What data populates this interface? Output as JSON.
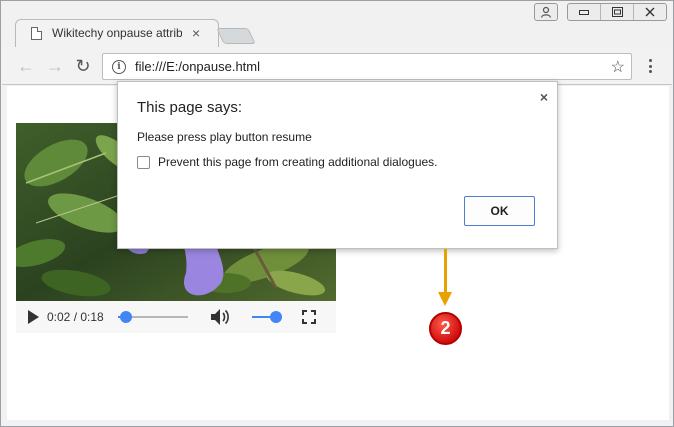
{
  "browser": {
    "tab": {
      "title": "Wikitechy onpause attrib",
      "close_glyph": "×"
    },
    "window_controls": {
      "minimize_glyph": "▭",
      "restore_glyph": "⧉",
      "close_glyph": "✕"
    },
    "toolbar": {
      "back_glyph": "←",
      "forward_glyph": "→",
      "reload_glyph": "↻",
      "url": "file:///E:/onpause.html",
      "info_glyph": "i",
      "star_glyph": "☆"
    }
  },
  "video_player": {
    "time": "0:02 / 0:18",
    "progress": 0.11,
    "volume": 0.8
  },
  "dialog": {
    "title": "This page says:",
    "close_glyph": "×",
    "message": "Please press play button resume",
    "checkbox_label": "Prevent this page from creating additional dialogues.",
    "checkbox_checked": false,
    "ok_label": "OK"
  },
  "annotation": {
    "badge_number": "2",
    "arrow_color": "#e9a100",
    "badge_color": "#d00f0f"
  },
  "colors": {
    "accent": "#4285f4",
    "dialog_button_border": "#4d7ed0"
  }
}
